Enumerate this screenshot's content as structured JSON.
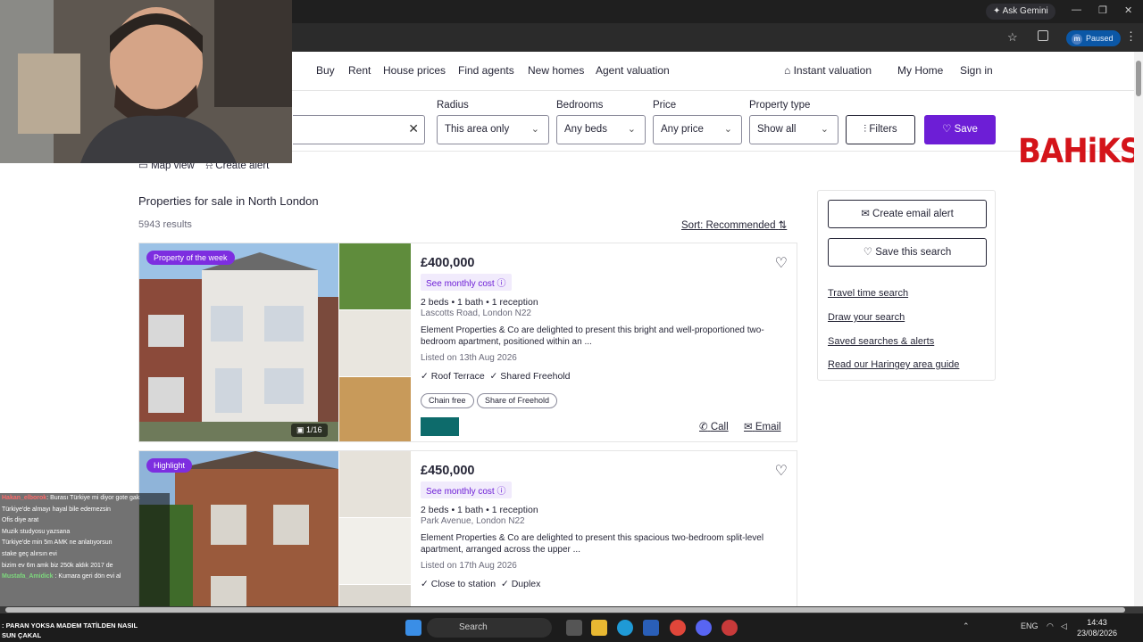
{
  "browser": {
    "ask_gemini": "Ask Gemini",
    "profile_initial": "m",
    "profile_status": "Paused"
  },
  "nav": {
    "links": [
      "Buy",
      "Rent",
      "House prices",
      "Find agents",
      "New homes",
      "Agent valuation"
    ],
    "instant_valuation": "Instant valuation",
    "my_home": "My Home",
    "sign_in": "Sign in"
  },
  "filters": {
    "radius_label": "Radius",
    "radius_value": "This area only",
    "bedrooms_label": "Bedrooms",
    "bedrooms_value": "Any beds",
    "price_label": "Price",
    "price_value": "Any price",
    "type_label": "Property type",
    "type_value": "Show all",
    "filters_button": "Filters",
    "save_button": "Save"
  },
  "overlay_logo": "BAHiKS",
  "map_view": "Map view",
  "create_alert": "Create alert",
  "listing": {
    "heading": "Properties for sale in North London",
    "results": "5943 results",
    "sort": "Sort: Recommended"
  },
  "cards": [
    {
      "badge": "Property of the week",
      "counter": "1/16",
      "price": "£400,000",
      "monthly": "See monthly cost",
      "beds": "2 beds • 1 bath • 1 reception",
      "address": "Lascotts Road, London N22",
      "description": "Element Properties & Co are delighted to present this bright and well-proportioned two-bedroom apartment, positioned within an ...",
      "listed": "Listed on 13th Aug 2026",
      "features": [
        "Roof Terrace",
        "Shared Freehold"
      ],
      "tags": [
        "Chain free",
        "Share of Freehold"
      ],
      "call": "Call",
      "email": "Email"
    },
    {
      "badge": "Highlight",
      "price": "£450,000",
      "monthly": "See monthly cost",
      "beds": "2 beds • 1 bath • 1 reception",
      "address": "Park Avenue, London N22",
      "description": "Element Properties & Co are delighted to present this spacious two-bedroom split-level apartment, arranged across the upper ...",
      "listed": "Listed on 17th Aug 2026",
      "features": [
        "Close to station",
        "Duplex"
      ]
    }
  ],
  "sidebar": {
    "email_alert": "Create email alert",
    "save_search": "Save this search",
    "links": [
      "Travel time search",
      "Draw your search",
      "Saved searches & alerts",
      "Read our Haringey area guide"
    ]
  },
  "chat": [
    {
      "user": "Hakan_elborok",
      "msg": "Burası Türkiye mi diyor gote gak"
    },
    {
      "user": "",
      "msg": "Türkiye'de almayı hayal bile edemezsin"
    },
    {
      "user": "",
      "msg": "Ofis diye arat"
    },
    {
      "user": "",
      "msg": "Muzik studyosu yazsana"
    },
    {
      "user": "",
      "msg": "Türkiye'de min 5m AMK ne anlatıyorsun"
    },
    {
      "user": "",
      "msg": "stake geç alırsın evi"
    },
    {
      "user": "",
      "msg": "bizim ev 6m amk biz 250k aldık 2017 de"
    },
    {
      "user": "Mustafa_Amidick",
      "msg": "Kumara geri dön evi al"
    }
  ],
  "bottom_overlay": ": PARAN YOKSA MADEM TATİLDEN NASIL\nSUN ÇAKAL",
  "taskbar": {
    "search": "Search",
    "lang": "ENG",
    "time": "14:43",
    "date": "23/08/2026"
  },
  "colors": {
    "accent": "#6d1ed6",
    "badge": "#7d2ee0",
    "logo_red": "#d4141a"
  }
}
